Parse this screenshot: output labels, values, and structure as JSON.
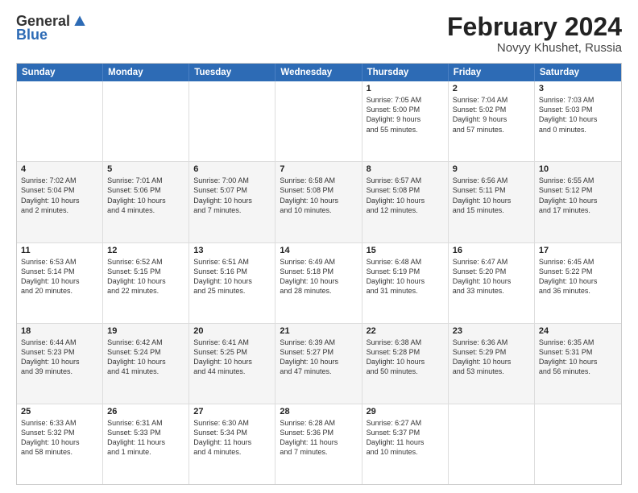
{
  "logo": {
    "general": "General",
    "blue": "Blue"
  },
  "header": {
    "month_year": "February 2024",
    "location": "Novyy Khushet, Russia"
  },
  "days_of_week": [
    "Sunday",
    "Monday",
    "Tuesday",
    "Wednesday",
    "Thursday",
    "Friday",
    "Saturday"
  ],
  "rows": [
    {
      "row_index": 0,
      "bg": "odd",
      "cells": [
        {
          "day": "",
          "info": ""
        },
        {
          "day": "",
          "info": ""
        },
        {
          "day": "",
          "info": ""
        },
        {
          "day": "",
          "info": ""
        },
        {
          "day": "1",
          "info": "Sunrise: 7:05 AM\nSunset: 5:00 PM\nDaylight: 9 hours\nand 55 minutes."
        },
        {
          "day": "2",
          "info": "Sunrise: 7:04 AM\nSunset: 5:02 PM\nDaylight: 9 hours\nand 57 minutes."
        },
        {
          "day": "3",
          "info": "Sunrise: 7:03 AM\nSunset: 5:03 PM\nDaylight: 10 hours\nand 0 minutes."
        }
      ]
    },
    {
      "row_index": 1,
      "bg": "even",
      "cells": [
        {
          "day": "4",
          "info": "Sunrise: 7:02 AM\nSunset: 5:04 PM\nDaylight: 10 hours\nand 2 minutes."
        },
        {
          "day": "5",
          "info": "Sunrise: 7:01 AM\nSunset: 5:06 PM\nDaylight: 10 hours\nand 4 minutes."
        },
        {
          "day": "6",
          "info": "Sunrise: 7:00 AM\nSunset: 5:07 PM\nDaylight: 10 hours\nand 7 minutes."
        },
        {
          "day": "7",
          "info": "Sunrise: 6:58 AM\nSunset: 5:08 PM\nDaylight: 10 hours\nand 10 minutes."
        },
        {
          "day": "8",
          "info": "Sunrise: 6:57 AM\nSunset: 5:08 PM\nDaylight: 10 hours\nand 12 minutes."
        },
        {
          "day": "9",
          "info": "Sunrise: 6:56 AM\nSunset: 5:11 PM\nDaylight: 10 hours\nand 15 minutes."
        },
        {
          "day": "10",
          "info": "Sunrise: 6:55 AM\nSunset: 5:12 PM\nDaylight: 10 hours\nand 17 minutes."
        }
      ]
    },
    {
      "row_index": 2,
      "bg": "odd",
      "cells": [
        {
          "day": "11",
          "info": "Sunrise: 6:53 AM\nSunset: 5:14 PM\nDaylight: 10 hours\nand 20 minutes."
        },
        {
          "day": "12",
          "info": "Sunrise: 6:52 AM\nSunset: 5:15 PM\nDaylight: 10 hours\nand 22 minutes."
        },
        {
          "day": "13",
          "info": "Sunrise: 6:51 AM\nSunset: 5:16 PM\nDaylight: 10 hours\nand 25 minutes."
        },
        {
          "day": "14",
          "info": "Sunrise: 6:49 AM\nSunset: 5:18 PM\nDaylight: 10 hours\nand 28 minutes."
        },
        {
          "day": "15",
          "info": "Sunrise: 6:48 AM\nSunset: 5:19 PM\nDaylight: 10 hours\nand 31 minutes."
        },
        {
          "day": "16",
          "info": "Sunrise: 6:47 AM\nSunset: 5:20 PM\nDaylight: 10 hours\nand 33 minutes."
        },
        {
          "day": "17",
          "info": "Sunrise: 6:45 AM\nSunset: 5:22 PM\nDaylight: 10 hours\nand 36 minutes."
        }
      ]
    },
    {
      "row_index": 3,
      "bg": "even",
      "cells": [
        {
          "day": "18",
          "info": "Sunrise: 6:44 AM\nSunset: 5:23 PM\nDaylight: 10 hours\nand 39 minutes."
        },
        {
          "day": "19",
          "info": "Sunrise: 6:42 AM\nSunset: 5:24 PM\nDaylight: 10 hours\nand 41 minutes."
        },
        {
          "day": "20",
          "info": "Sunrise: 6:41 AM\nSunset: 5:25 PM\nDaylight: 10 hours\nand 44 minutes."
        },
        {
          "day": "21",
          "info": "Sunrise: 6:39 AM\nSunset: 5:27 PM\nDaylight: 10 hours\nand 47 minutes."
        },
        {
          "day": "22",
          "info": "Sunrise: 6:38 AM\nSunset: 5:28 PM\nDaylight: 10 hours\nand 50 minutes."
        },
        {
          "day": "23",
          "info": "Sunrise: 6:36 AM\nSunset: 5:29 PM\nDaylight: 10 hours\nand 53 minutes."
        },
        {
          "day": "24",
          "info": "Sunrise: 6:35 AM\nSunset: 5:31 PM\nDaylight: 10 hours\nand 56 minutes."
        }
      ]
    },
    {
      "row_index": 4,
      "bg": "odd",
      "cells": [
        {
          "day": "25",
          "info": "Sunrise: 6:33 AM\nSunset: 5:32 PM\nDaylight: 10 hours\nand 58 minutes."
        },
        {
          "day": "26",
          "info": "Sunrise: 6:31 AM\nSunset: 5:33 PM\nDaylight: 11 hours\nand 1 minute."
        },
        {
          "day": "27",
          "info": "Sunrise: 6:30 AM\nSunset: 5:34 PM\nDaylight: 11 hours\nand 4 minutes."
        },
        {
          "day": "28",
          "info": "Sunrise: 6:28 AM\nSunset: 5:36 PM\nDaylight: 11 hours\nand 7 minutes."
        },
        {
          "day": "29",
          "info": "Sunrise: 6:27 AM\nSunset: 5:37 PM\nDaylight: 11 hours\nand 10 minutes."
        },
        {
          "day": "",
          "info": ""
        },
        {
          "day": "",
          "info": ""
        }
      ]
    }
  ]
}
